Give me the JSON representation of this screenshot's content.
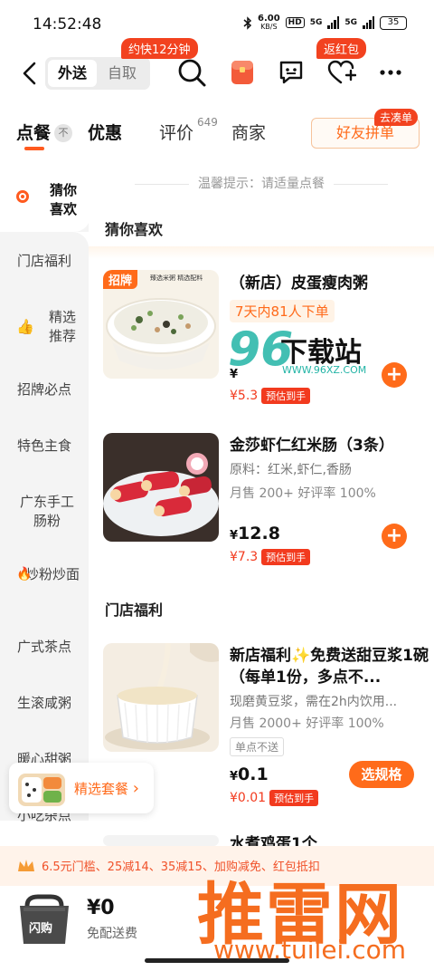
{
  "status": {
    "time": "14:52:48",
    "speed_value": "6.00",
    "speed_unit": "KB/S",
    "hd": "HD",
    "net1": "5G",
    "net2": "5G",
    "battery": "35"
  },
  "header": {
    "mode_active": "外送",
    "mode_inactive": "自取",
    "eta_tag": "约快12分钟",
    "redpacket_tag": "返红包"
  },
  "tabs": {
    "order": "点餐",
    "order_badge": "不",
    "deals": "优惠",
    "reviews": "评价",
    "reviews_count": "649",
    "merchant": "商家",
    "friend_order": "好友拼单",
    "friend_tag": "去凑单"
  },
  "sidebar": {
    "items": [
      {
        "label": "猜你喜欢"
      },
      {
        "label": "门店福利"
      },
      {
        "label": "精选推荐"
      },
      {
        "label": "招牌必点"
      },
      {
        "label": "特色主食"
      },
      {
        "label": "广东手工肠粉"
      },
      {
        "label": "炒粉炒面"
      },
      {
        "label": "广式茶点"
      },
      {
        "label": "生滚咸粥"
      },
      {
        "label": "暖心甜粥"
      },
      {
        "label": "小吃杂点"
      }
    ]
  },
  "content": {
    "notice": "温馨提示：请适量点餐",
    "section_guess": "猜你喜欢",
    "section_welfare": "门店福利",
    "dishes": [
      {
        "badge": "招牌",
        "img_caption": "臻选米粥 精选配料",
        "name": "（新店）皮蛋瘦肉粥",
        "chip": "7天内81人下单",
        "price_yen": "¥",
        "disc_price": "¥5.3",
        "disc_tag": "预估到手"
      },
      {
        "name": "金莎虾仁红米肠（3条）",
        "ingredients": "原料：红米,虾仁,香肠",
        "stats": "月售 200+ 好评率 100%",
        "price_yen": "¥",
        "price": "12.8",
        "disc_price": "¥7.3",
        "disc_tag": "预估到手"
      },
      {
        "name": "新店福利✨免费送甜豆浆1碗（每单1份，多点不...",
        "desc": "现磨黄豆浆，需在2h内饮用...",
        "stats": "月售 2000+ 好评率 100%",
        "note": "单点不送",
        "price_yen": "¥",
        "price": "0.1",
        "disc_price": "¥0.01",
        "disc_tag": "预估到手",
        "spec_button": "选规格"
      },
      {
        "name": "水煮鸡蛋1个"
      }
    ],
    "combo_label": "精选套餐",
    "combo_arrow": "›"
  },
  "promo": {
    "text": "6.5元门槛、25减14、35减15、加购减免、红包抵扣"
  },
  "cart": {
    "badge": "闪购",
    "price": "¥0",
    "delivery": "免配送费"
  },
  "watermarks": {
    "site96_num": "96",
    "site96_text": "下载站",
    "site96_url": "WWW.96XZ.COM",
    "tuilei_text": "推雷网",
    "tuilei_url": "www.tuilei.com"
  },
  "colors": {
    "accent": "#ff6b1a",
    "price_red": "#f23a1e",
    "tag_red": "#f2421f",
    "sidebar_bg": "#f4f4f4"
  }
}
